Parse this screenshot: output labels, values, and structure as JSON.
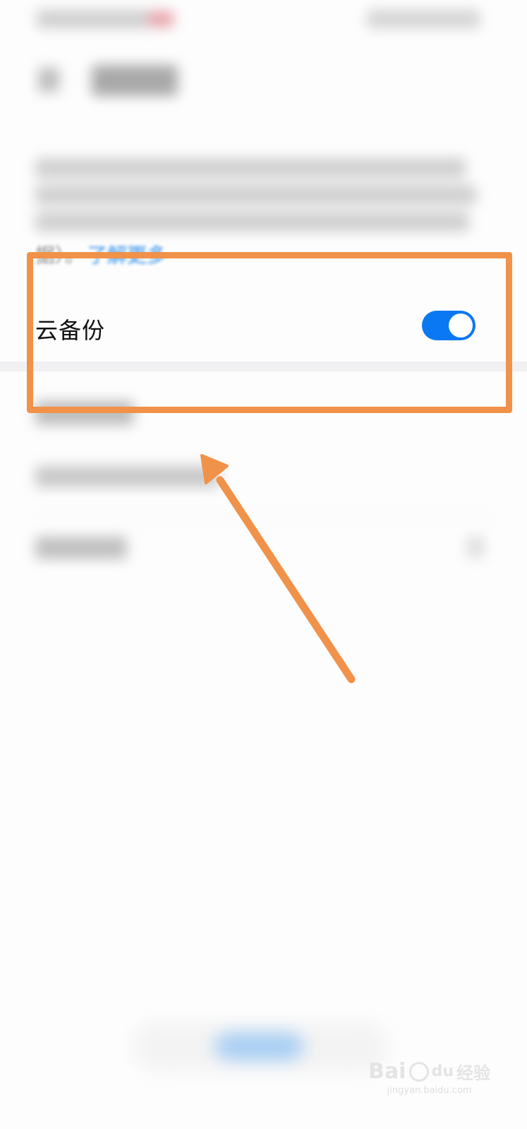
{
  "settings": {
    "description_tail": "据）。",
    "learn_more_link": "了解更多",
    "cloud_backup": {
      "label": "云备份",
      "enabled": true
    }
  },
  "watermark": {
    "brand": "Bai",
    "brand_suffix": "经验",
    "url": "jingyan.baidu.com"
  },
  "colors": {
    "accent": "#0a78f2",
    "annotation": "#f0924a",
    "link": "#6eb0ef"
  }
}
